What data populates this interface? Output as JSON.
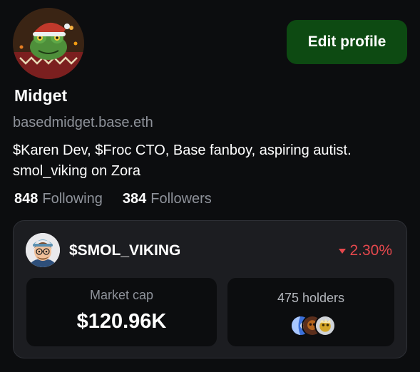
{
  "profile": {
    "avatar_icon": "christmas-frog-avatar",
    "display_name": "Midget",
    "handle": "basedmidget.base.eth",
    "bio": "$Karen Dev, $Froc CTO, Base fanboy, aspiring autist. smol_viking on Zora",
    "edit_button": "Edit profile",
    "following_count": "848",
    "following_label": "Following",
    "followers_count": "384",
    "followers_label": "Followers"
  },
  "coin": {
    "avatar_icon": "viking-boy-avatar",
    "symbol": "$SMOL_VIKING",
    "change": "2.30%",
    "change_direction": "down",
    "change_color": "#e5484d",
    "market_cap_label": "Market cap",
    "market_cap_value": "$120.96K",
    "holders_label": "475 holders",
    "holder_avatars": [
      "holder-avatar-blue",
      "holder-avatar-brown",
      "holder-avatar-gold"
    ]
  },
  "colors": {
    "background": "#0c0d0f",
    "card": "#1c1d21",
    "button": "#0d4a12",
    "muted_text": "#8e929a"
  }
}
